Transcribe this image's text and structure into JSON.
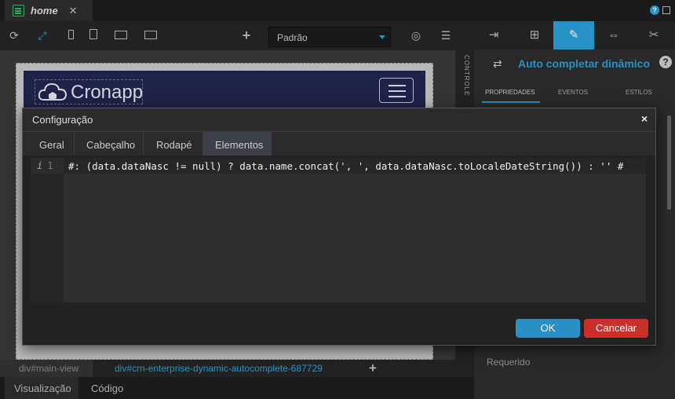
{
  "top_tab": {
    "label": "home",
    "close": "✕"
  },
  "toolbar": {
    "theme_select": "Padrão",
    "add": "+"
  },
  "canvas": {
    "logo_text": "Cronapp",
    "side_label": "CONTROLE"
  },
  "breadcrumb": {
    "items": [
      "div#main-view",
      "div#crn-enterprise-dynamic-autocomplete-687729"
    ],
    "add": "+"
  },
  "bottom_tabs": [
    "Visualização",
    "Código"
  ],
  "right_panel": {
    "title": "Auto completar dinâmico",
    "help": "?",
    "tabs": [
      "PROPRIEDADES",
      "EVENTOS",
      "ESTILOS"
    ],
    "field_label": "Requerido"
  },
  "modal": {
    "title": "Configuração",
    "close": "×",
    "tabs": [
      "Geral",
      "Cabeçalho",
      "Rodapé",
      "Elementos"
    ],
    "active_tab": "Elementos",
    "editor": {
      "line_number": "1",
      "info_marker": "i",
      "code": "#: (data.dataNasc != null) ? data.name.concat(', ', data.dataNasc.toLocaleDateString()) : '' #"
    },
    "ok_label": "OK",
    "cancel_label": "Cancelar"
  },
  "colors": {
    "accent": "#2a9fd6",
    "ok": "#2a8fc4",
    "cancel": "#c9302c",
    "navbar": "#222550"
  }
}
